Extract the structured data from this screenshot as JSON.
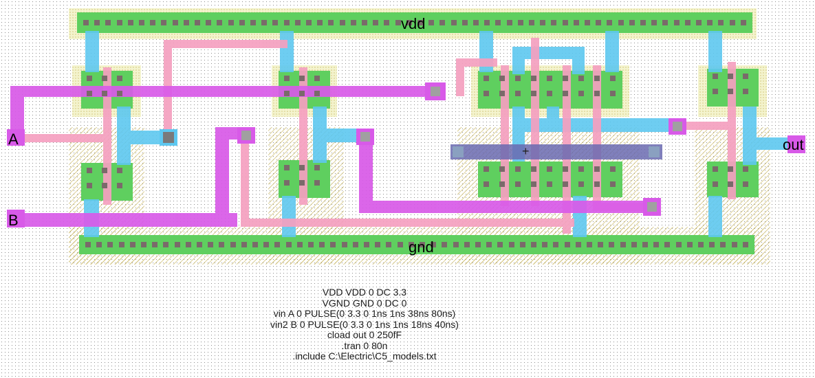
{
  "labels": {
    "vdd": "vdd",
    "gnd": "gnd",
    "in_a": "A",
    "in_b": "B",
    "out": "out"
  },
  "spice_lines": [
    "VDD VDD 0 DC 3.3",
    "VGND GND 0 DC 0",
    "vin A 0 PULSE(0 3.3 0 1ns 1ns 38ns 80ns)",
    "vin2 B 0 PULSE(0 3.3 0 1ns 1ns 18ns 40ns)",
    "cload out 0 250fF",
    ".tran 0 80n",
    ".include C:\\Electric\\C5_models.txt"
  ],
  "colors": {
    "background": "#ffffff",
    "metal1": "#5ec8f0",
    "metal2": "#d85ae8",
    "poly": "#f5a0c0",
    "active": "#5fcf5f",
    "contact": "#7a7a7a",
    "select_hatch": "#e0d070",
    "well": "#6a6ab0",
    "text": "#000000"
  }
}
